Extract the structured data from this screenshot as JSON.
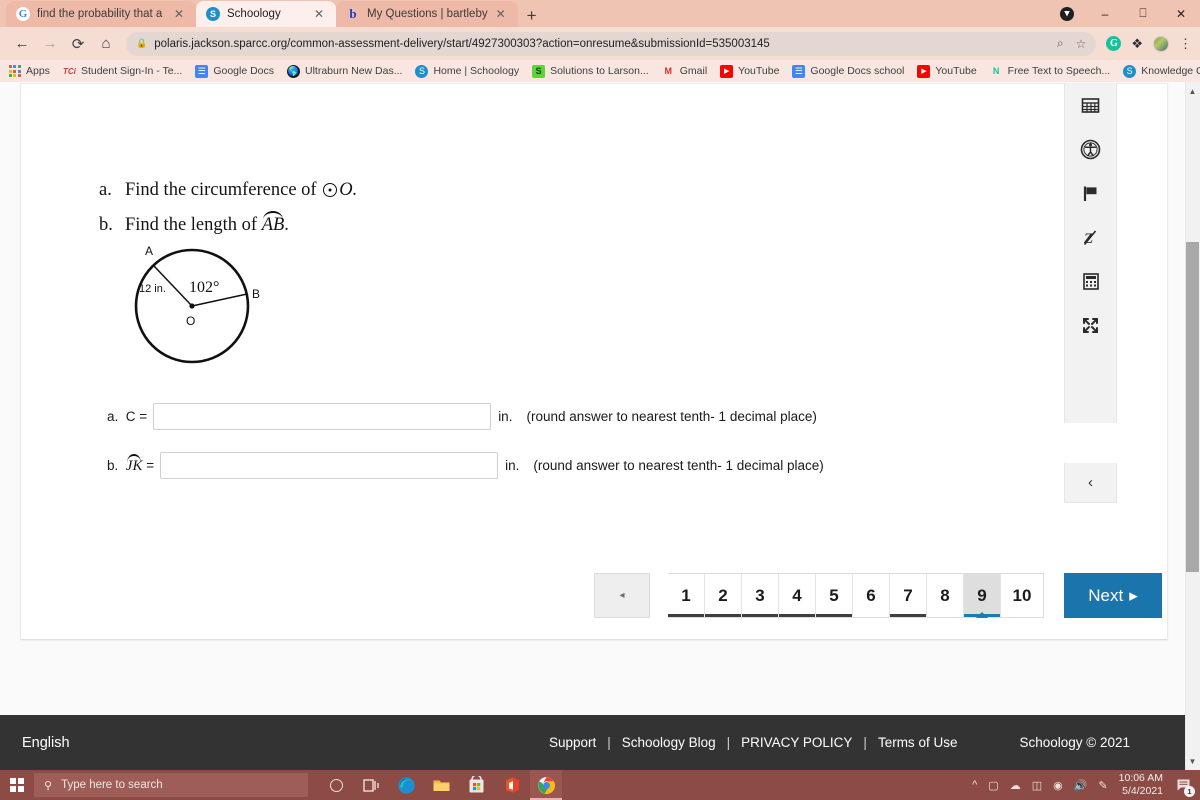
{
  "browser": {
    "tabs": [
      {
        "title": "find the probability that a random",
        "favicon": "google-icon",
        "active": false
      },
      {
        "title": "Schoology",
        "favicon": "schoology-icon",
        "active": true
      },
      {
        "title": "My Questions | bartleby",
        "favicon": "bartleby-icon",
        "active": false
      }
    ],
    "new_tab_label": "+",
    "window_controls": {
      "minimize": "–",
      "maximize": "❐",
      "close": "✕"
    },
    "nav": {
      "back": "←",
      "forward": "→",
      "reload": "⟳",
      "home": "⌂"
    },
    "omnibox": {
      "url": "polaris.jackson.sparcc.org/common-assessment-delivery/start/4927300303?action=onresume&submissionId=535003145",
      "lock_icon": "lock-icon",
      "zoom_icon": "zoom-icon",
      "star_icon": "star-icon"
    },
    "extensions": {
      "grammarly": "G",
      "puzzle": "✦",
      "menu": "⋮"
    },
    "bookmarks": [
      {
        "label": "Apps",
        "icon": "apps-grid-icon"
      },
      {
        "label": "Student Sign-In - Te...",
        "icon": "tci-icon"
      },
      {
        "label": "Google Docs",
        "icon": "docs-icon"
      },
      {
        "label": "Ultraburn New Das...",
        "icon": "globe-icon"
      },
      {
        "label": "Home | Schoology",
        "icon": "schoology-icon"
      },
      {
        "label": "Solutions to Larson...",
        "icon": "slader-icon"
      },
      {
        "label": "Gmail",
        "icon": "gmail-icon"
      },
      {
        "label": "YouTube",
        "icon": "youtube-icon"
      },
      {
        "label": "Google Docs school",
        "icon": "docs-icon"
      },
      {
        "label": "YouTube",
        "icon": "youtube-icon"
      },
      {
        "label": "Free Text to Speech...",
        "icon": "naturalreader-icon"
      },
      {
        "label": "Knowledge Check:...",
        "icon": "schoology-icon"
      }
    ]
  },
  "question": {
    "part_a": {
      "label": "a.",
      "text_before": "Find the circumference of",
      "symbol": "circle-o-icon",
      "text_after": "O."
    },
    "part_b": {
      "label": "b.",
      "text_before": "Find the length of",
      "arc_var": "AB",
      "text_after": "."
    },
    "figure": {
      "point_a": "A",
      "point_b": "B",
      "center": "O",
      "radius_label": "12 in.",
      "angle_label": "102°"
    },
    "answers": [
      {
        "label": "a.",
        "variable": "C",
        "variable_is_arc": false,
        "equals": "=",
        "value": "",
        "unit": "in.",
        "hint": "(round answer to nearest tenth- 1 decimal place)"
      },
      {
        "label": "b.",
        "variable": "JK",
        "variable_is_arc": true,
        "equals": "=",
        "value": "",
        "unit": "in.",
        "hint": "(round answer to nearest tenth- 1 decimal place)"
      }
    ]
  },
  "pagination": {
    "prev_label": "◂",
    "next_label": "Next",
    "next_arrow": "▸",
    "current_page": 9,
    "pages": [
      {
        "number": "1",
        "answered": true
      },
      {
        "number": "2",
        "answered": true
      },
      {
        "number": "3",
        "answered": true
      },
      {
        "number": "4",
        "answered": true
      },
      {
        "number": "5",
        "answered": true
      },
      {
        "number": "6",
        "answered": false
      },
      {
        "number": "7",
        "answered": true
      },
      {
        "number": "8",
        "answered": false
      },
      {
        "number": "9",
        "answered": false
      },
      {
        "number": "10",
        "answered": false
      }
    ],
    "accent_color": "#1b75ad"
  },
  "toolrail": {
    "tools": [
      {
        "name": "periodic-table-icon"
      },
      {
        "name": "accessibility-icon"
      },
      {
        "name": "flag-icon"
      },
      {
        "name": "strikethrough-icon"
      },
      {
        "name": "calculator-icon"
      },
      {
        "name": "fullscreen-icon"
      }
    ],
    "collapse_label": "‹"
  },
  "footer": {
    "language": "English",
    "links": [
      "Support",
      "Schoology Blog",
      "PRIVACY POLICY",
      "Terms of Use"
    ],
    "separator": "|",
    "copyright": "Schoology © 2021"
  },
  "taskbar": {
    "search_placeholder": "Type here to search",
    "search_icon": "search-icon",
    "start_icon": "windows-icon",
    "cortana_icon": "cortana-icon",
    "taskview_icon": "task-view-icon",
    "apps": [
      "edge-icon",
      "file-explorer-icon",
      "microsoft-store-icon",
      "office-icon",
      "chrome-icon"
    ],
    "tray": [
      "chevron-up-icon",
      "onedrive-meet-icon",
      "cloud-icon",
      "battery-icon",
      "wifi-icon",
      "volume-icon",
      "pen-icon"
    ],
    "time": "10:06 AM",
    "date": "5/4/2021",
    "notification_count": "1"
  }
}
